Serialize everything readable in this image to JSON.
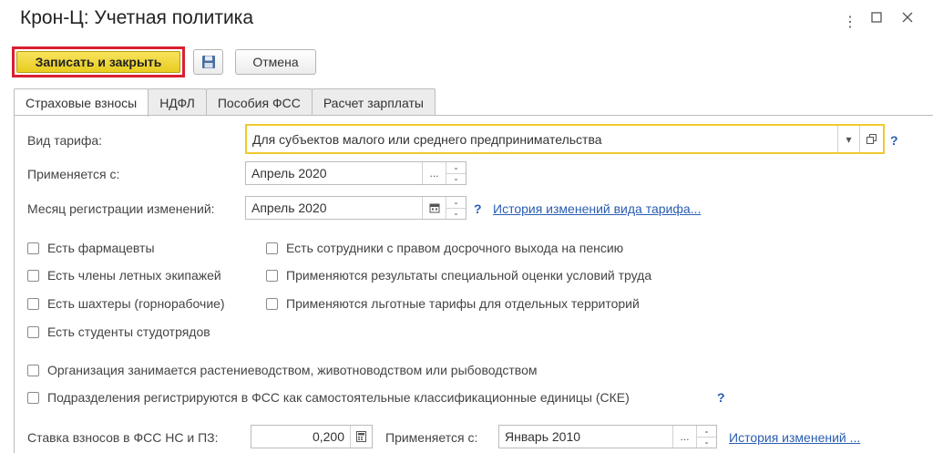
{
  "window": {
    "title": "Крон-Ц: Учетная политика",
    "controls": [
      "more-icon",
      "maximize-icon",
      "close-icon"
    ]
  },
  "toolbar": {
    "save_close_label": "Записать и закрыть",
    "cancel_label": "Отмена"
  },
  "tabs": [
    {
      "label": "Страховые взносы",
      "active": true
    },
    {
      "label": "НДФЛ",
      "active": false
    },
    {
      "label": "Пособия ФСС",
      "active": false
    },
    {
      "label": "Расчет зарплаты",
      "active": false
    }
  ],
  "form": {
    "tariff_type": {
      "label": "Вид тарифа:",
      "value": "Для субъектов малого или среднего предпринимательства",
      "help": "?"
    },
    "applies_from": {
      "label": "Применяется с:",
      "value": "Апрель 2020",
      "button": "..."
    },
    "reg_month": {
      "label": "Месяц регистрации изменений:",
      "value": "Апрель 2020",
      "help": "?",
      "history_link": "История изменений вида тарифа..."
    },
    "checkboxes_left": [
      {
        "label": "Есть фармацевты",
        "checked": false
      },
      {
        "label": "Есть члены летных экипажей",
        "checked": false
      },
      {
        "label": "Есть шахтеры (горнорабочие)",
        "checked": false
      },
      {
        "label": "Есть студенты студотрядов",
        "checked": false
      }
    ],
    "checkboxes_right": [
      {
        "label": "Есть сотрудники с правом досрочного выхода на пенсию",
        "checked": false
      },
      {
        "label": "Применяются результаты специальной оценки условий труда",
        "checked": false
      },
      {
        "label": "Применяются льготные тарифы для отдельных территорий",
        "checked": false
      }
    ],
    "checkboxes_wide": [
      {
        "label": "Организация занимается растениеводством, животноводством или рыбоводством",
        "checked": false
      },
      {
        "label": "Подразделения регистрируются в ФСС как самостоятельные классификационные единицы (СКЕ)",
        "checked": false
      }
    ],
    "wide_help": "?",
    "fss_rate": {
      "label": "Ставка взносов в ФСС НС и ПЗ:",
      "value": "0,200",
      "applies_label": "Применяется с:",
      "applies_value": "Январь 2010",
      "button": "...",
      "history_link": "История изменений ..."
    }
  }
}
